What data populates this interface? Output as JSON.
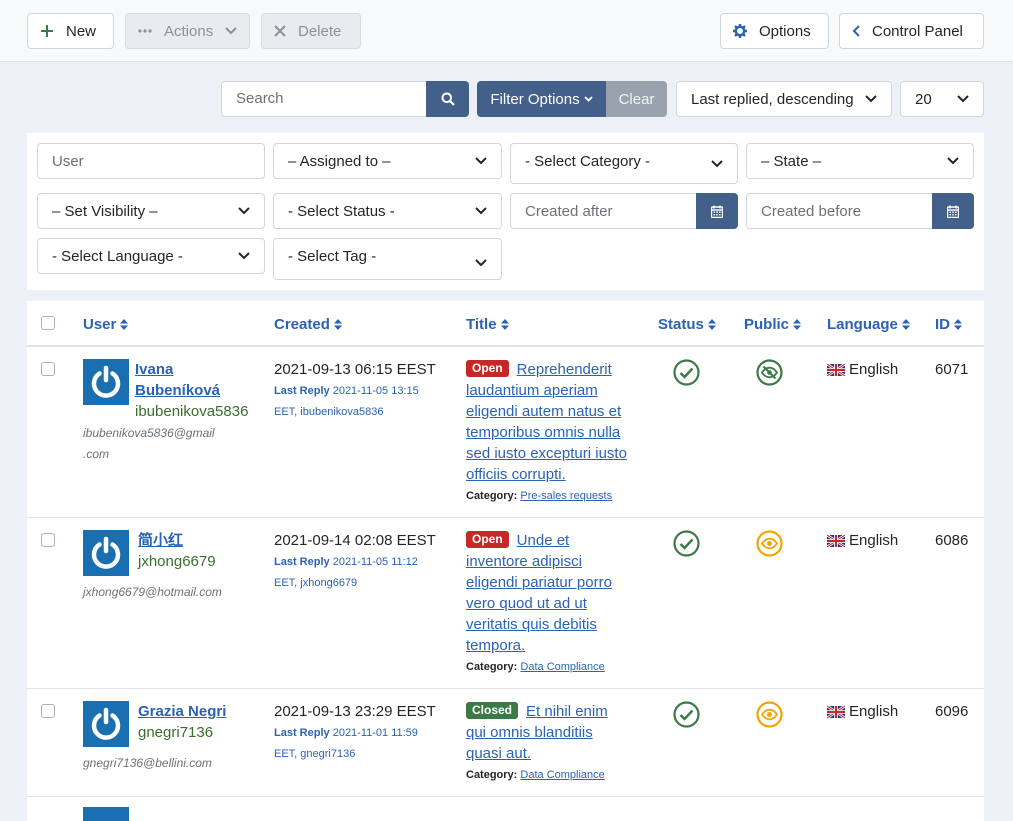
{
  "toolbar": {
    "new_label": "New",
    "actions_label": "Actions",
    "delete_label": "Delete",
    "options_label": "Options",
    "control_panel_label": "Control Panel"
  },
  "searchbar": {
    "search_placeholder": "Search",
    "filter_options_label": "Filter Options",
    "clear_label": "Clear",
    "ordering": "Last replied, descending",
    "limit": "20"
  },
  "filters": {
    "user_placeholder": "User",
    "assigned_to": "– Assigned to –",
    "category": "- Select Category -",
    "state": "– State –",
    "visibility": "– Set Visibility –",
    "status": "- Select Status -",
    "created_after": "Created after",
    "created_before": "Created before",
    "language": "- Select Language -",
    "tag": "- Select Tag -"
  },
  "table": {
    "columns": {
      "user": "User",
      "created": "Created",
      "title": "Title",
      "status": "Status",
      "public": "Public",
      "language": "Language",
      "id": "ID"
    },
    "rows": [
      {
        "name_line1": "Ivana",
        "name_line2": "Bubeníková",
        "login": "ibubenikova5836",
        "email_line1": "ibubenikova5836@gmail",
        "email_line2": ".com",
        "created": "2021-09-13 06:15 EEST",
        "last_reply_label": "Last Reply",
        "last_reply_line1": "2021-11-05 13:15",
        "last_reply_line2": "EET, ibubenikova5836",
        "badge": "Open",
        "title_lines": [
          "Reprehenderit",
          "laudantium aperiam",
          "eligendi autem natus et",
          "temporibus omnis nulla",
          "sed iusto excepturi iusto",
          "officiis corrupti."
        ],
        "category_label": "Category:",
        "category": "Pre-sales requests",
        "public_state": "hidden",
        "language": "English",
        "id": "6071"
      },
      {
        "name_line1": "简小红",
        "login": "jxhong6679",
        "email_line1": "jxhong6679@hotmail.com",
        "created": "2021-09-14 02:08 EEST",
        "last_reply_label": "Last Reply",
        "last_reply_line1": "2021-11-05 11:12",
        "last_reply_line2": "EET, jxhong6679",
        "badge": "Open",
        "title_lines": [
          "Unde et",
          "inventore adipisci",
          "eligendi pariatur porro",
          "vero quod ut ad ut",
          "veritatis quis debitis",
          "tempora."
        ],
        "category_label": "Category:",
        "category": "Data Compliance",
        "public_state": "visible",
        "language": "English",
        "id": "6086"
      },
      {
        "name_line1": "Grazia Negri",
        "login": "gnegri7136",
        "email_line1": "gnegri7136@bellini.com",
        "created": "2021-09-13 23:29 EEST",
        "last_reply_label": "Last Reply",
        "last_reply_line1": "2021-11-01 11:59",
        "last_reply_line2": "EET, gnegri7136",
        "badge": "Closed",
        "title_lines": [
          "Et nihil enim",
          "qui omnis blanditiis",
          "quasi aut."
        ],
        "category_label": "Category:",
        "category": "Data Compliance",
        "public_state": "visible",
        "language": "English",
        "id": "6096"
      }
    ]
  },
  "colors": {
    "accent": "#42608a",
    "link": "#2a63b6",
    "open_badge": "#c62828",
    "closed_badge": "#3c7a45",
    "status_ok": "#3c7a45",
    "public_visible": "#f0a500"
  },
  "icons": [
    "plus-icon",
    "ellipsis-icon",
    "chevron-down-icon",
    "close-icon",
    "gear-icon",
    "chevron-left-icon",
    "search-icon",
    "calendar-icon",
    "sort-icon",
    "power-icon",
    "check-circle-icon",
    "eye-icon",
    "eye-slash-icon",
    "uk-flag-icon"
  ]
}
